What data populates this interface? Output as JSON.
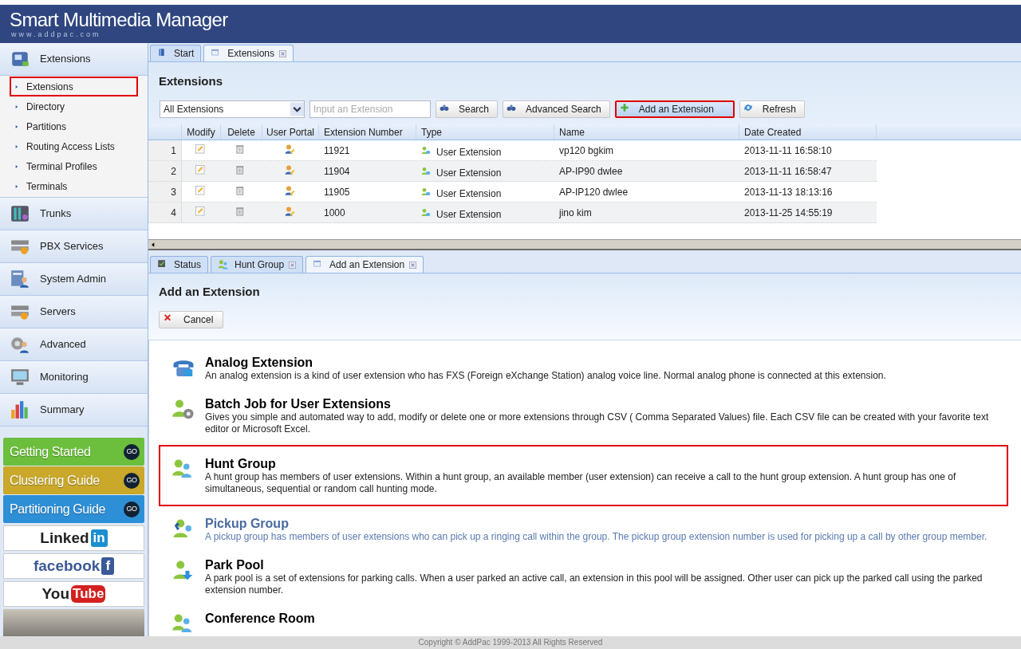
{
  "app": {
    "title": "Smart Multimedia Manager",
    "subtitle": "www.addpac.com"
  },
  "sidebar": {
    "sections": [
      {
        "label": "Extensions",
        "children": [
          {
            "label": "Extensions",
            "highlighted": true
          },
          {
            "label": "Directory",
            "highlighted": false
          },
          {
            "label": "Partitions",
            "highlighted": false
          },
          {
            "label": "Routing Access Lists",
            "highlighted": false
          },
          {
            "label": "Terminal Profiles",
            "highlighted": false
          },
          {
            "label": "Terminals",
            "highlighted": false
          }
        ]
      },
      {
        "label": "Trunks"
      },
      {
        "label": "PBX Services"
      },
      {
        "label": "System Admin"
      },
      {
        "label": "Servers"
      },
      {
        "label": "Advanced"
      },
      {
        "label": "Monitoring"
      },
      {
        "label": "Summary"
      }
    ],
    "guides": [
      {
        "label": "Getting Started",
        "badge": "GO",
        "color": "#6cbf3c"
      },
      {
        "label": "Clustering Guide",
        "badge": "GO",
        "color": "#c9a82a"
      },
      {
        "label": "Partitioning Guide",
        "badge": "GO",
        "color": "#2d8fd6"
      }
    ],
    "social": [
      {
        "kind": "linkedin",
        "label": "Linked",
        "mark": "in"
      },
      {
        "kind": "facebook",
        "label": "facebook",
        "mark": "f"
      },
      {
        "kind": "youtube",
        "label": "You",
        "mark": "Tube"
      }
    ]
  },
  "top_tabs": [
    {
      "label": "Start",
      "selected": false,
      "closable": false
    },
    {
      "label": "Extensions",
      "selected": true,
      "closable": true
    }
  ],
  "extensions_panel": {
    "title": "Extensions",
    "filter": "All Extensions",
    "search": {
      "placeholder": "Input an Extension"
    },
    "buttons": [
      {
        "label": "Search",
        "highlighted": false
      },
      {
        "label": "Advanced Search",
        "highlighted": false
      },
      {
        "label": "Add an Extension",
        "highlighted": true
      },
      {
        "label": "Refresh",
        "highlighted": false
      }
    ],
    "table": {
      "columns": [
        "Modify",
        "Delete",
        "User Portal",
        "Extension Number",
        "Type",
        "Name",
        "Date Created"
      ],
      "rows": [
        {
          "index": "1",
          "number": "11921",
          "type": "User Extension",
          "name": "vp120 bgkim",
          "date": "2013-11-11 16:58:10"
        },
        {
          "index": "2",
          "number": "11904",
          "type": "User Extension",
          "name": "AP-IP90 dwlee",
          "date": "2013-11-11 16:58:47"
        },
        {
          "index": "3",
          "number": "11905",
          "type": "User Extension",
          "name": "AP-IP120 dwlee",
          "date": "2013-11-13 18:13:16"
        },
        {
          "index": "4",
          "number": "1000",
          "type": "User Extension",
          "name": "jino kim",
          "date": "2013-11-25 14:55:19"
        }
      ]
    }
  },
  "bottom_tabs": [
    {
      "label": "Status",
      "selected": false,
      "closable": false
    },
    {
      "label": "Hunt Group",
      "selected": false,
      "closable": true
    },
    {
      "label": "Add an Extension",
      "selected": true,
      "closable": true
    }
  ],
  "add_panel": {
    "title": "Add an Extension",
    "cancel": "Cancel",
    "options": [
      {
        "title": "Analog Extension",
        "highlighted": false,
        "hovered": false,
        "description": "An analog extension is a kind of user extension who has FXS (Foreign eXchange Station) analog voice line. Normal analog phone is connected at this extension."
      },
      {
        "title": "Batch Job for User Extensions",
        "highlighted": false,
        "hovered": false,
        "description": "Gives you simple and automated way to add, modify or delete one or more extensions through CSV ( Comma Separated Values) file. Each CSV file can be created with your favorite text editor or Microsoft Excel."
      },
      {
        "title": "Hunt Group",
        "highlighted": true,
        "hovered": false,
        "description": "A hunt group has members of user extensions. Within a hunt group, an available member (user extension) can receive a call to the hunt group extension. A hunt group has one of simultaneous, sequential or random call hunting mode."
      },
      {
        "title": "Pickup Group",
        "highlighted": false,
        "hovered": true,
        "description": "A pickup group has members of user extensions who can pick up a ringing call within the group. The pickup group extension number is used for picking up a call by other group member."
      },
      {
        "title": "Park Pool",
        "highlighted": false,
        "hovered": false,
        "description": "A park pool is a set of extensions for parking calls. When a user parked an active call, an extension in this pool will be assigned. Other user can pick up the parked call using the parked extension number."
      },
      {
        "title": "Conference Room",
        "highlighted": false,
        "hovered": false
      }
    ]
  },
  "footer": "Copyright © AddPac 1999-2013 All Rights Reserved"
}
